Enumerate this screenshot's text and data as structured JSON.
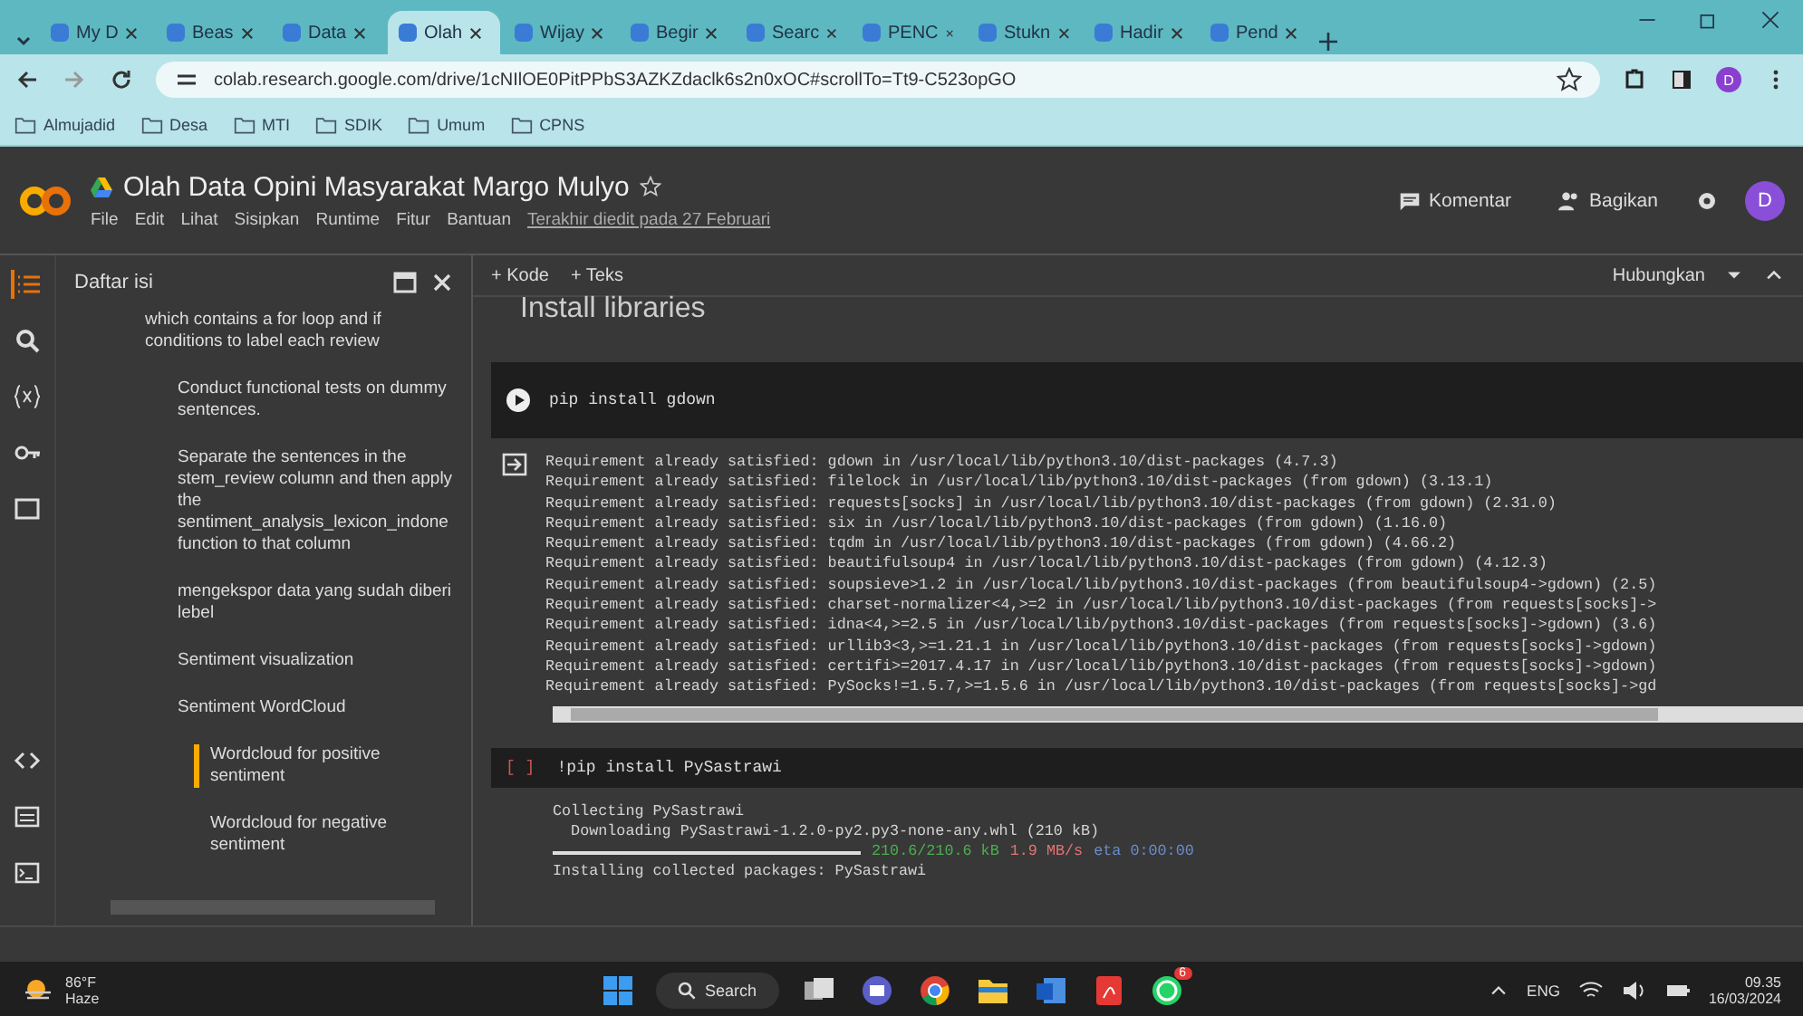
{
  "browser": {
    "tabs": [
      {
        "label": "My D",
        "selected": false
      },
      {
        "label": "Beas",
        "selected": false
      },
      {
        "label": "Data",
        "selected": false
      },
      {
        "label": "Olah",
        "selected": true
      },
      {
        "label": "Wijay",
        "selected": false
      },
      {
        "label": "Begir",
        "selected": false
      },
      {
        "label": "Searc",
        "selected": false
      },
      {
        "label": "PENC",
        "selected": false
      },
      {
        "label": "Stukn",
        "selected": false
      },
      {
        "label": "Hadir",
        "selected": false
      },
      {
        "label": "Pend",
        "selected": false
      }
    ],
    "url": "colab.research.google.com/drive/1cNIlOE0PitPPbS3AZKZdaclk6s2n0xOC#scrollTo=Tt9-C523opGO",
    "profile_initial": "D",
    "bookmarks": [
      "Almujadid",
      "Desa",
      "MTI",
      "SDIK",
      "Umum",
      "CPNS"
    ]
  },
  "colab": {
    "title": "Olah Data Opini Masyarakat Margo Mulyo",
    "menu": [
      "File",
      "Edit",
      "Lihat",
      "Sisipkan",
      "Runtime",
      "Fitur",
      "Bantuan"
    ],
    "last_edit": "Terakhir diedit pada 27 Februari",
    "comment": "Komentar",
    "share": "Bagikan",
    "avatar": "D"
  },
  "sidebar": {
    "title": "Daftar isi",
    "items": [
      {
        "label": "which contains a for loop and if conditions to label each review",
        "selected": false,
        "children": [
          {
            "label": "Conduct functional tests on dummy sentences.",
            "selected": false
          },
          {
            "label": "Separate the sentences in the stem_review column and then apply the sentiment_analysis_lexicon_indone function to that column",
            "selected": false
          },
          {
            "label": "mengekspor data yang sudah diberi lebel",
            "selected": false
          },
          {
            "label": "Sentiment visualization",
            "selected": false
          },
          {
            "label": "Sentiment WordCloud",
            "selected": false,
            "children": [
              {
                "label": "Wordcloud for positive sentiment",
                "selected": true
              },
              {
                "label": "Wordcloud for negative sentiment",
                "selected": false
              }
            ]
          }
        ]
      }
    ]
  },
  "toolbar": {
    "add_code": "+ Kode",
    "add_text": "+ Teks",
    "connect": "Hubungkan"
  },
  "notebook": {
    "section": "Install libraries",
    "cells": [
      {
        "code": "pip install gdown",
        "kind": "executed",
        "output": [
          "Requirement already satisfied: gdown in /usr/local/lib/python3.10/dist-packages (4.7.3)",
          "Requirement already satisfied: filelock in /usr/local/lib/python3.10/dist-packages (from gdown) (3.13.1)",
          "Requirement already satisfied: requests[socks] in /usr/local/lib/python3.10/dist-packages (from gdown) (2.31.0)",
          "Requirement already satisfied: six in /usr/local/lib/python3.10/dist-packages (from gdown) (1.16.0)",
          "Requirement already satisfied: tqdm in /usr/local/lib/python3.10/dist-packages (from gdown) (4.66.2)",
          "Requirement already satisfied: beautifulsoup4 in /usr/local/lib/python3.10/dist-packages (from gdown) (4.12.3)",
          "Requirement already satisfied: soupsieve>1.2 in /usr/local/lib/python3.10/dist-packages (from beautifulsoup4->gdown) (2.5)",
          "Requirement already satisfied: charset-normalizer<4,>=2 in /usr/local/lib/python3.10/dist-packages (from requests[socks]->",
          "Requirement already satisfied: idna<4,>=2.5 in /usr/local/lib/python3.10/dist-packages (from requests[socks]->gdown) (3.6)",
          "Requirement already satisfied: urllib3<3,>=1.21.1 in /usr/local/lib/python3.10/dist-packages (from requests[socks]->gdown)",
          "Requirement already satisfied: certifi>=2017.4.17 in /usr/local/lib/python3.10/dist-packages (from requests[socks]->gdown)",
          "Requirement already satisfied: PySocks!=1.5.7,>=1.5.6 in /usr/local/lib/python3.10/dist-packages (from requests[socks]->gd"
        ]
      },
      {
        "code": "!pip install PySastrawi",
        "kind": "queued",
        "status_mark": "[ ]",
        "output": [
          "Collecting PySastrawi",
          "  Downloading PySastrawi-1.2.0-py2.py3-none-any.whl (210 kB)"
        ],
        "progress": {
          "level": 1,
          "size": "210.6/210.6 kB",
          "speed": "1.9 MB/s",
          "eta": "eta 0:00:00"
        },
        "tail": "Installing collected packages: PySastrawi"
      }
    ]
  },
  "taskbar": {
    "temperature": "86°F",
    "weather": "Haze",
    "search": "Search",
    "whatsapp_badge": "6",
    "language": "ENG",
    "time": "09.35",
    "date": "16/03/2024"
  }
}
